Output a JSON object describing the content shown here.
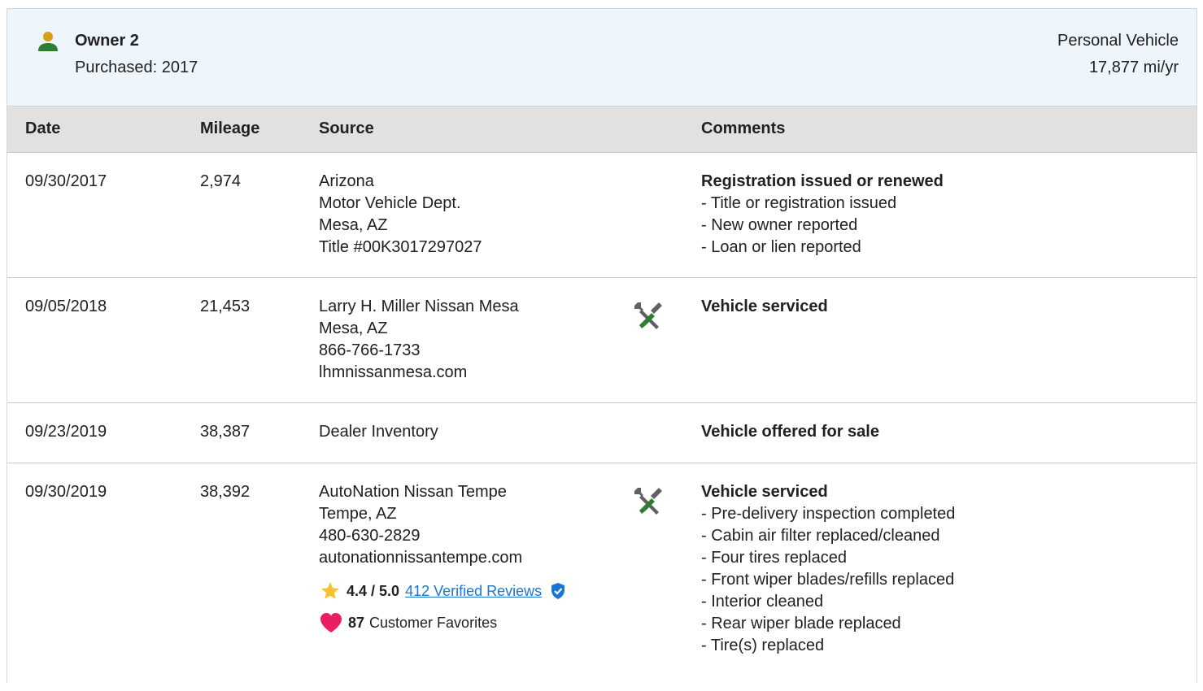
{
  "owner": {
    "name": "Owner 2",
    "purchased": "Purchased: 2017",
    "use_type": "Personal Vehicle",
    "miles_per_year": "17,877 mi/yr",
    "icon": "person-icon",
    "icon_color": "#2e7d32"
  },
  "table": {
    "headers": {
      "date": "Date",
      "mileage": "Mileage",
      "source": "Source",
      "comments": "Comments"
    },
    "rows": [
      {
        "date": "09/30/2017",
        "mileage": "2,974",
        "source": [
          "Arizona",
          "Motor Vehicle Dept.",
          "Mesa, AZ",
          "Title #00K3017297027"
        ],
        "service_icon": false,
        "comment_title": "Registration issued or renewed",
        "comment_items": [
          "- Title or registration issued",
          "- New owner reported",
          "- Loan or lien reported"
        ]
      },
      {
        "date": "09/05/2018",
        "mileage": "21,453",
        "source": [
          "Larry H. Miller Nissan Mesa",
          "Mesa, AZ",
          "866-766-1733",
          "lhmnissanmesa.com"
        ],
        "service_icon": true,
        "comment_title": "Vehicle serviced",
        "comment_items": []
      },
      {
        "date": "09/23/2019",
        "mileage": "38,387",
        "source": [
          "Dealer Inventory"
        ],
        "service_icon": false,
        "comment_title": "Vehicle offered for sale",
        "comment_items": []
      },
      {
        "date": "09/30/2019",
        "mileage": "38,392",
        "source": [
          "AutoNation Nissan Tempe",
          "Tempe, AZ",
          "480-630-2829",
          "autonationnissantempe.com"
        ],
        "service_icon": true,
        "rating": {
          "value": "4.4 / 5.0",
          "reviews_link": "412 Verified Reviews",
          "favorites_count": "87",
          "favorites_label": "Customer Favorites"
        },
        "comment_title": "Vehicle serviced",
        "comment_items": [
          "- Pre-delivery inspection completed",
          "- Cabin air filter replaced/cleaned",
          "- Four tires replaced",
          "- Front wiper blades/refills replaced",
          "- Interior cleaned",
          "- Rear wiper blade replaced",
          "- Tire(s) replaced"
        ]
      }
    ]
  },
  "colors": {
    "header_bg": "#eef5fb",
    "table_head_bg": "#e1e1e1",
    "link": "#1976d2",
    "star": "#fbc02d",
    "heart": "#e91e63",
    "verified": "#1976d2",
    "wrench_green": "#2e7d32"
  }
}
